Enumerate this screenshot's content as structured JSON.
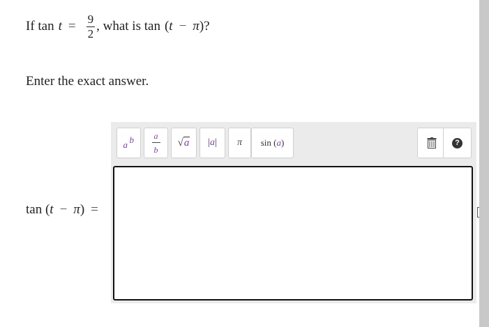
{
  "question": {
    "prefix": "If tan",
    "var": "t",
    "equals": "=",
    "frac_num": "9",
    "frac_den": "2",
    "middle": ", what is tan",
    "expr_open": "(",
    "expr_var": "t",
    "expr_minus": "−",
    "expr_pi": "π",
    "expr_close": ")?"
  },
  "instruction": "Enter the exact answer.",
  "toolbar": {
    "exp_base": "a",
    "exp_pow": "b",
    "frac_top": "a",
    "frac_bottom": "b",
    "sqrt_radical": "√",
    "sqrt_arg": "a",
    "abs_left": "|",
    "abs_arg": "a",
    "abs_right": "|",
    "pi": "π",
    "sin_name": "sin",
    "sin_open": " (",
    "sin_arg": "a",
    "sin_close": ")",
    "help_glyph": "?"
  },
  "answer_input": {
    "value": ""
  },
  "lhs": {
    "fn": "tan",
    "open": " (",
    "var": "t",
    "minus": "−",
    "pi": "π",
    "close": ")",
    "equals": "="
  },
  "colors": {
    "accent_var": "#7b3fa0",
    "panel_bg": "#ebebeb",
    "scrollbar": "#c8c8c8"
  }
}
